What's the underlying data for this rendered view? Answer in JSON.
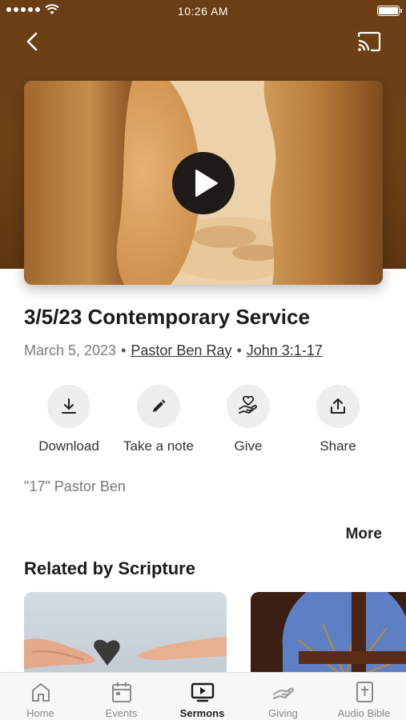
{
  "status_bar": {
    "time": "10:26 AM"
  },
  "sermon": {
    "title": "3/5/23 Contemporary Service",
    "date": "March 5, 2023",
    "speaker": "Pastor Ben Ray",
    "scripture": "John 3:1-17",
    "description": "\"17\" Pastor Ben"
  },
  "actions": [
    {
      "label": "Download",
      "icon": "download-icon"
    },
    {
      "label": "Take a note",
      "icon": "pencil-icon"
    },
    {
      "label": "Give",
      "icon": "giving-hand-heart-icon"
    },
    {
      "label": "Share",
      "icon": "share-icon"
    }
  ],
  "more_label": "More",
  "related": {
    "title": "Related by Scripture"
  },
  "tabs": [
    {
      "label": "Home",
      "icon": "home-icon",
      "active": false
    },
    {
      "label": "Events",
      "icon": "calendar-icon",
      "active": false
    },
    {
      "label": "Sermons",
      "icon": "tv-play-icon",
      "active": true
    },
    {
      "label": "Giving",
      "icon": "giving-hand-icon",
      "active": false
    },
    {
      "label": "Audio Bible",
      "icon": "bible-icon",
      "active": false
    }
  ],
  "colors": {
    "hero": "#6b3e14",
    "active_tab": "#1c1c1c",
    "inactive_tab": "#8a8a8a"
  }
}
